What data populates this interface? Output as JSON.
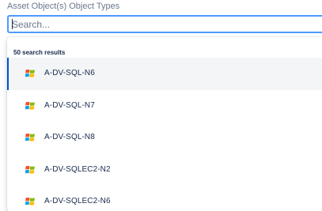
{
  "field": {
    "label": "Asset Object(s) Object Types",
    "search_placeholder": "Search...",
    "search_value": ""
  },
  "dropdown": {
    "results_count": "50 search results",
    "items": [
      {
        "label": "A-DV-SQL-N6",
        "icon": "windows-icon",
        "highlighted": true
      },
      {
        "label": "A-DV-SQL-N7",
        "icon": "windows-icon"
      },
      {
        "label": "A-DV-SQL-N8",
        "icon": "windows-icon"
      },
      {
        "label": "A-DV-SQLEC2-N2",
        "icon": "windows-icon"
      },
      {
        "label": "A-DV-SQLEC2-N6",
        "icon": "windows-icon"
      }
    ]
  },
  "colors": {
    "focus_border": "#4c9aff",
    "highlight_bar": "#0052cc",
    "highlight_bg": "#f4f5f7",
    "text": "#172b4d",
    "muted": "#6b778c"
  }
}
